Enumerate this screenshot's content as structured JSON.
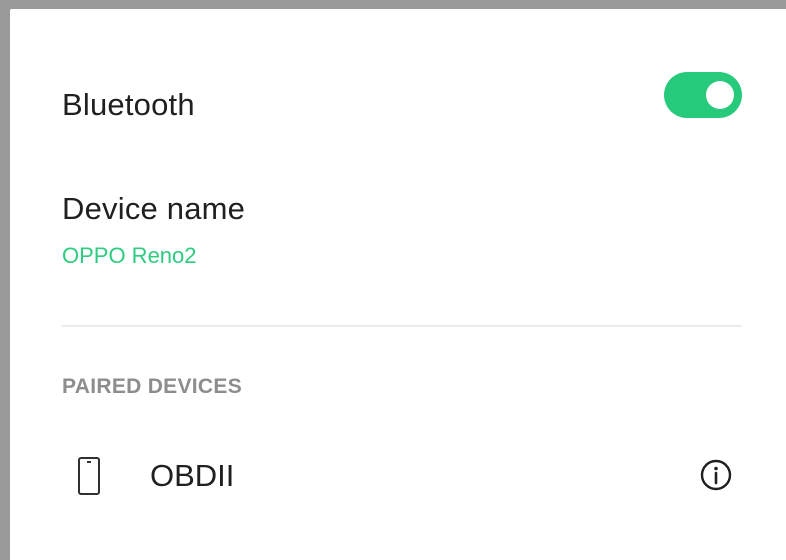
{
  "bluetooth": {
    "label": "Bluetooth",
    "enabled": true
  },
  "device_name": {
    "label": "Device name",
    "value": "OPPO Reno2"
  },
  "paired_devices": {
    "header": "PAIRED DEVICES",
    "items": [
      {
        "name": "OBDII",
        "icon": "phone-icon",
        "action_icon": "info-icon"
      }
    ]
  },
  "colors": {
    "accent": "#2ecc80",
    "toggle_on": "#27c97a",
    "text_primary": "#202020",
    "text_secondary": "#8d8d8d",
    "frame": "#9a9a9a"
  }
}
